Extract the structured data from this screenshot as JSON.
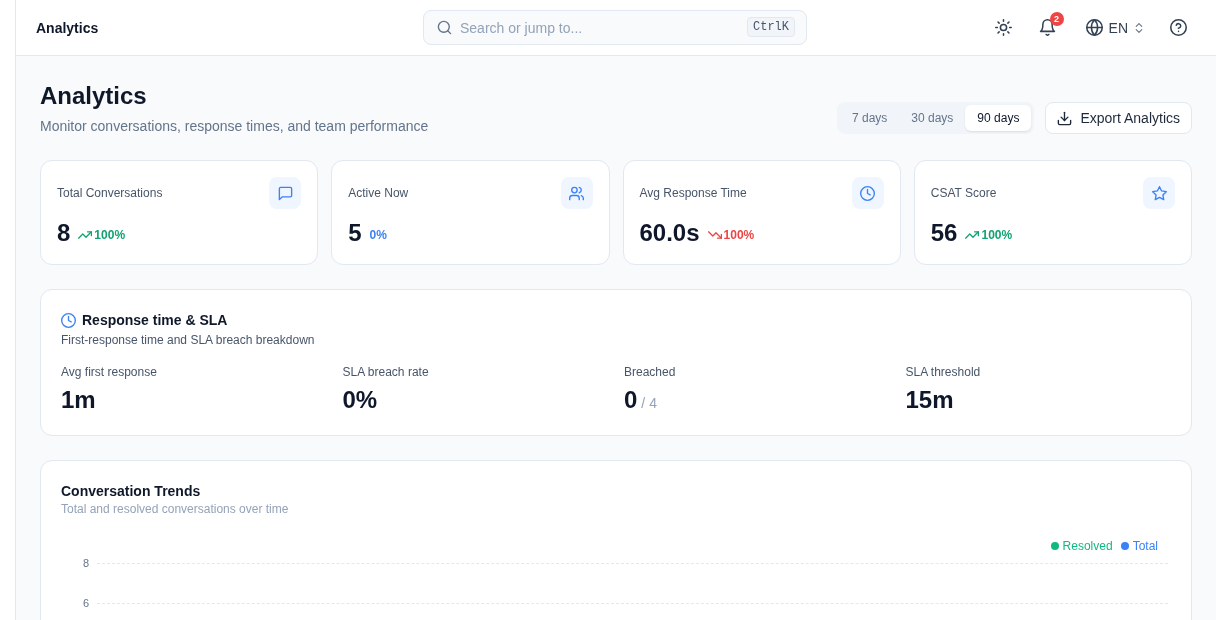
{
  "topbar": {
    "title": "Analytics",
    "search": {
      "placeholder": "Search or jump to...",
      "shortcut": "CtrlK"
    },
    "notifications": {
      "count": "2"
    },
    "language": "EN"
  },
  "header": {
    "title": "Analytics",
    "subtitle": "Monitor conversations, response times, and team performance",
    "ranges": [
      {
        "label": "7 days",
        "selected": false
      },
      {
        "label": "30 days",
        "selected": false
      },
      {
        "label": "90 days",
        "selected": true
      }
    ],
    "export_button": "Export Analytics"
  },
  "stats": [
    {
      "label": "Total Conversations",
      "value": "8",
      "trend": {
        "kind": "up",
        "text": "100%"
      }
    },
    {
      "label": "Active Now",
      "value": "5",
      "trend": {
        "kind": "flat",
        "text": "0%"
      }
    },
    {
      "label": "Avg Response Time",
      "value": "60.0s",
      "trend": {
        "kind": "down",
        "text": "100%"
      }
    },
    {
      "label": "CSAT Score",
      "value": "56",
      "trend": {
        "kind": "up",
        "text": "100%"
      }
    }
  ],
  "sla": {
    "title": "Response time & SLA",
    "subtitle": "First-response time and SLA breach breakdown",
    "metrics": [
      {
        "label": "Avg first response",
        "value": "1m"
      },
      {
        "label": "SLA breach rate",
        "value": "0%"
      },
      {
        "label": "Breached",
        "value": "0",
        "total": "/ 4"
      },
      {
        "label": "SLA threshold",
        "value": "15m"
      }
    ]
  },
  "trends": {
    "title": "Conversation Trends",
    "subtitle": "Total and resolved conversations over time",
    "legend": [
      {
        "label": "Resolved",
        "color": "#10b981"
      },
      {
        "label": "Total",
        "color": "#3b82f6"
      }
    ],
    "y_ticks": [
      "8",
      "6"
    ]
  }
}
